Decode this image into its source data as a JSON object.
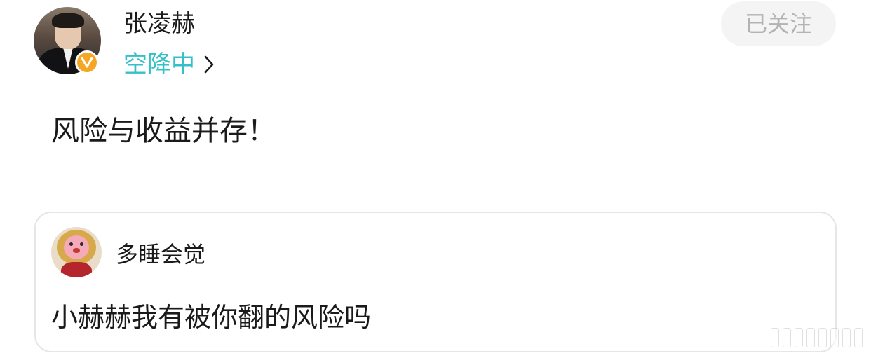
{
  "post": {
    "author": {
      "name": "张凌赫",
      "tag": "空降中",
      "verified_badge": "V",
      "verified_badge_color": "#f5a623"
    },
    "follow_button_label": "已关注",
    "text": "风险与收益并存！"
  },
  "quoted": {
    "author_name": "多睡会觉",
    "text": "小赫赫我有被你翻的风险吗"
  },
  "colors": {
    "accent_teal": "#35c0c8",
    "follow_button_bg": "#f4f4f4",
    "follow_button_text": "#b3b3b3",
    "card_border": "#e6e6e6"
  },
  "icons": {
    "tag_arrow": "chevron-right-icon",
    "verified": "verified-v-badge-icon"
  }
}
